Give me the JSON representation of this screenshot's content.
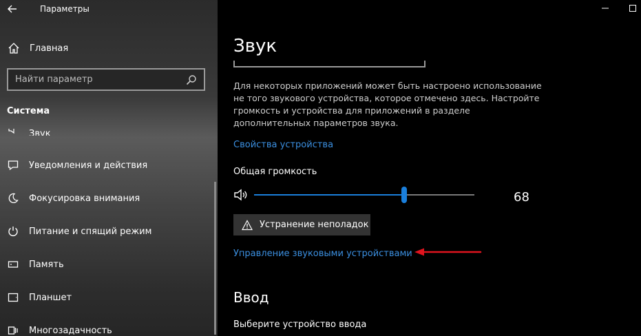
{
  "window": {
    "title": "Параметры"
  },
  "sidebar": {
    "home_label": "Главная",
    "search": {
      "placeholder": "Найти параметр",
      "value": ""
    },
    "section_title": "Система",
    "clipped_item": "Звук",
    "items": [
      {
        "label": "Уведомления и действия",
        "icon": "notification-icon"
      },
      {
        "label": "Фокусировка внимания",
        "icon": "moon-icon"
      },
      {
        "label": "Питание и спящий режим",
        "icon": "power-icon"
      },
      {
        "label": "Память",
        "icon": "storage-icon"
      },
      {
        "label": "Планшет",
        "icon": "tablet-icon"
      },
      {
        "label": "Многозадачность",
        "icon": "multitasking-icon"
      }
    ]
  },
  "main": {
    "page_title": "Звук",
    "description": "Для некоторых приложений может быть настроено использование не того звукового устройства, которое отмечено здесь. Настройте громкость и устройства для приложений в разделе дополнительных параметров звука.",
    "device_properties_link": "Свойства устройства",
    "volume": {
      "label": "Общая громкость",
      "value": "68",
      "level": 0.68
    },
    "troubleshoot_button": "Устранение неполадок",
    "manage_devices_link": "Управление звуковыми устройствами",
    "input_section_title": "Ввод",
    "input_device_label": "Выберите устройство ввода"
  },
  "colors": {
    "accent": "#1a7fdc",
    "link": "#3b8fe0",
    "arrow": "#e0141e"
  }
}
